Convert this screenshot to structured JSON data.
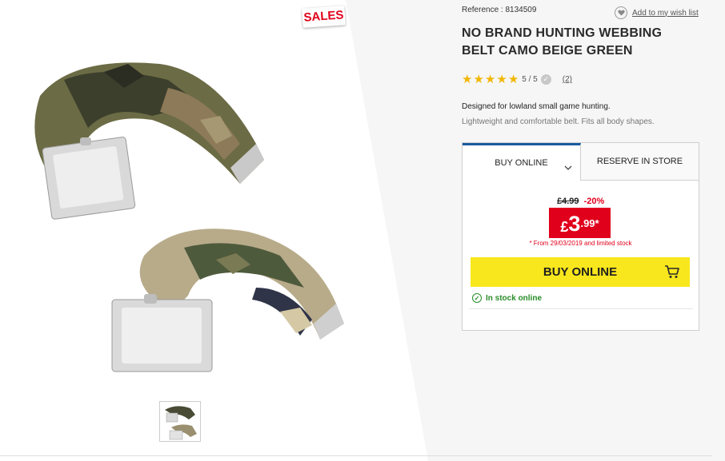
{
  "badges": {
    "sales": "SALES"
  },
  "product": {
    "reference": "Reference : 8134509",
    "wishlist_label": "Add to my wish list",
    "title": "NO BRAND HUNTING WEBBING BELT CAMO BEIGE GREEN",
    "rating": {
      "score_text": "5 / 5",
      "stars": 5,
      "reviews_label": "(2)"
    },
    "description_line1": "Designed for lowland small game hunting.",
    "description_line2": "Lightweight and comfortable belt. Fits all body shapes."
  },
  "buybox": {
    "tabs": [
      {
        "label": "BUY ONLINE",
        "active": true
      },
      {
        "label": "RESERVE IN STORE",
        "active": false
      }
    ],
    "old_price": "£4.99",
    "discount": "-20%",
    "price": {
      "currency": "£",
      "units": "3",
      "cents": ".99*"
    },
    "price_note": "* From 29/03/2019 and limited stock",
    "buy_button_label": "BUY ONLINE",
    "stock_label": "In stock online"
  },
  "icons": {
    "wishlist": "heart-icon",
    "cart": "cart-icon",
    "stock": "check-circle-icon",
    "tab_dropdown": "chevron-down-icon"
  },
  "colors": {
    "accent_red": "#e0001b",
    "buy_yellow": "#f8e71c",
    "star_yellow": "#f2b705",
    "stock_green": "#2a8c2a",
    "tab_blue": "#1a5aa0"
  }
}
